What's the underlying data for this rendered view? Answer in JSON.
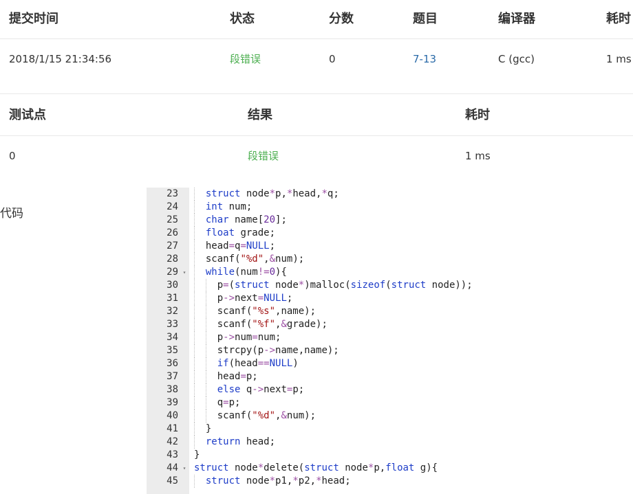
{
  "submission": {
    "headers": [
      "提交时间",
      "状态",
      "分数",
      "题目",
      "编译器",
      "耗时"
    ],
    "time": "2018/1/15 21:34:56",
    "status": "段错误",
    "score": "0",
    "problem": "7-13",
    "compiler": "C (gcc)",
    "duration": "1 ms"
  },
  "testpoints": {
    "headers": [
      "测试点",
      "结果",
      "耗时"
    ],
    "rows": [
      {
        "id": "0",
        "result": "段错误",
        "duration": "1 ms"
      }
    ]
  },
  "code_label": "代码",
  "colors": {
    "status_error": "#4caf50",
    "link": "#2a6aa8",
    "keyword": "#1e3dc8",
    "string": "#a31515",
    "number": "#6a2c9c"
  },
  "code": [
    {
      "n": "23",
      "fold": "",
      "indent": 1,
      "text": "struct node*p,*head,*q;"
    },
    {
      "n": "24",
      "fold": "",
      "indent": 1,
      "text": "int num;"
    },
    {
      "n": "25",
      "fold": "",
      "indent": 1,
      "text": "char name[20];"
    },
    {
      "n": "26",
      "fold": "",
      "indent": 1,
      "text": "float grade;"
    },
    {
      "n": "27",
      "fold": "",
      "indent": 1,
      "text": "head=q=NULL;"
    },
    {
      "n": "28",
      "fold": "",
      "indent": 1,
      "text": "scanf(\"%d\",&num);"
    },
    {
      "n": "29",
      "fold": "▾",
      "indent": 1,
      "text": "while(num!=0){"
    },
    {
      "n": "30",
      "fold": "",
      "indent": 2,
      "text": "p=(struct node*)malloc(sizeof(struct node));"
    },
    {
      "n": "31",
      "fold": "",
      "indent": 2,
      "text": "p->next=NULL;"
    },
    {
      "n": "32",
      "fold": "",
      "indent": 2,
      "text": "scanf(\"%s\",name);"
    },
    {
      "n": "33",
      "fold": "",
      "indent": 2,
      "text": "scanf(\"%f\",&grade);"
    },
    {
      "n": "34",
      "fold": "",
      "indent": 2,
      "text": "p->num=num;"
    },
    {
      "n": "35",
      "fold": "",
      "indent": 2,
      "text": "strcpy(p->name,name);"
    },
    {
      "n": "36",
      "fold": "",
      "indent": 2,
      "text": "if(head==NULL)"
    },
    {
      "n": "37",
      "fold": "",
      "indent": 2,
      "text": "head=p;"
    },
    {
      "n": "38",
      "fold": "",
      "indent": 2,
      "text": "else q->next=p;"
    },
    {
      "n": "39",
      "fold": "",
      "indent": 2,
      "text": "q=p;"
    },
    {
      "n": "40",
      "fold": "",
      "indent": 2,
      "text": "scanf(\"%d\",&num);"
    },
    {
      "n": "41",
      "fold": "",
      "indent": 1,
      "text": "}"
    },
    {
      "n": "42",
      "fold": "",
      "indent": 1,
      "text": "return head;"
    },
    {
      "n": "43",
      "fold": "",
      "indent": 0,
      "text": "}"
    },
    {
      "n": "44",
      "fold": "▾",
      "indent": 0,
      "text": "struct node*delete(struct node*p,float g){"
    },
    {
      "n": "45",
      "fold": "",
      "indent": 1,
      "text": "struct node*p1,*p2,*head;"
    }
  ]
}
